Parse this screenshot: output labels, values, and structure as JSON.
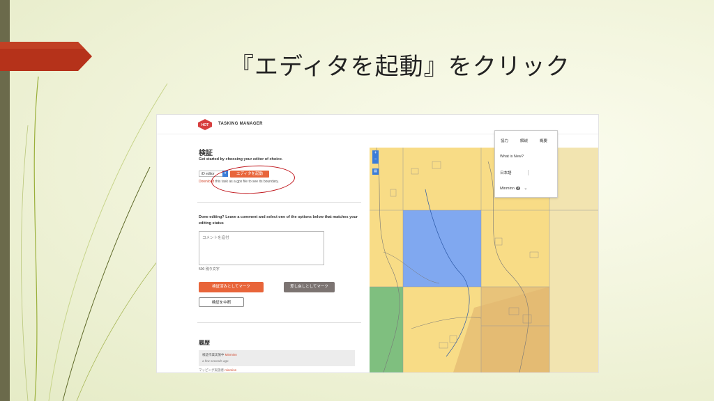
{
  "slide": {
    "title": "『エディタを起動』をクリック",
    "accent_color": "#b5321a",
    "highlight_color": "#c0161c"
  },
  "app": {
    "brand": "TASKING MANAGER",
    "logo_text": "HOT"
  },
  "panel": {
    "heading": "検証",
    "intro": "Get started by choosing your editor of choice.",
    "editor_select_value": "iD editor",
    "launch_button": "エディタを起動",
    "download_link": "Download",
    "download_rest": "this task as a gpx file to see its boundary.",
    "done_text": "Done editing? Leave a comment and select one of the options below that matches your editing status",
    "comment_placeholder": "コメントを追付",
    "char_count": "500 残り文字",
    "validate_button": "検証済みとしてマーク",
    "invalidate_button": "差し戻しとしてマーク",
    "stop_button": "検証を中断",
    "history_heading": "履歴",
    "history": [
      {
        "action": "検証作業実施中",
        "user": "Minminn",
        "time": "a few seconds ago"
      }
    ],
    "history_next_action": "マッピング実施者",
    "history_next_user": "minminn"
  },
  "nav": {
    "items": [
      "協力",
      "解説",
      "概要"
    ],
    "whats_new": "What is New?",
    "language": "日本語",
    "user": "Minminn",
    "user_badge": "4"
  },
  "map": {
    "zoom_in": "+",
    "zoom_out": "−",
    "layers_icon": "layers-icon",
    "colors": {
      "mapped": "#f8dc86",
      "selected": "#80a8f0",
      "validated": "#7fbf7f",
      "base": "#f2e4b0"
    }
  }
}
